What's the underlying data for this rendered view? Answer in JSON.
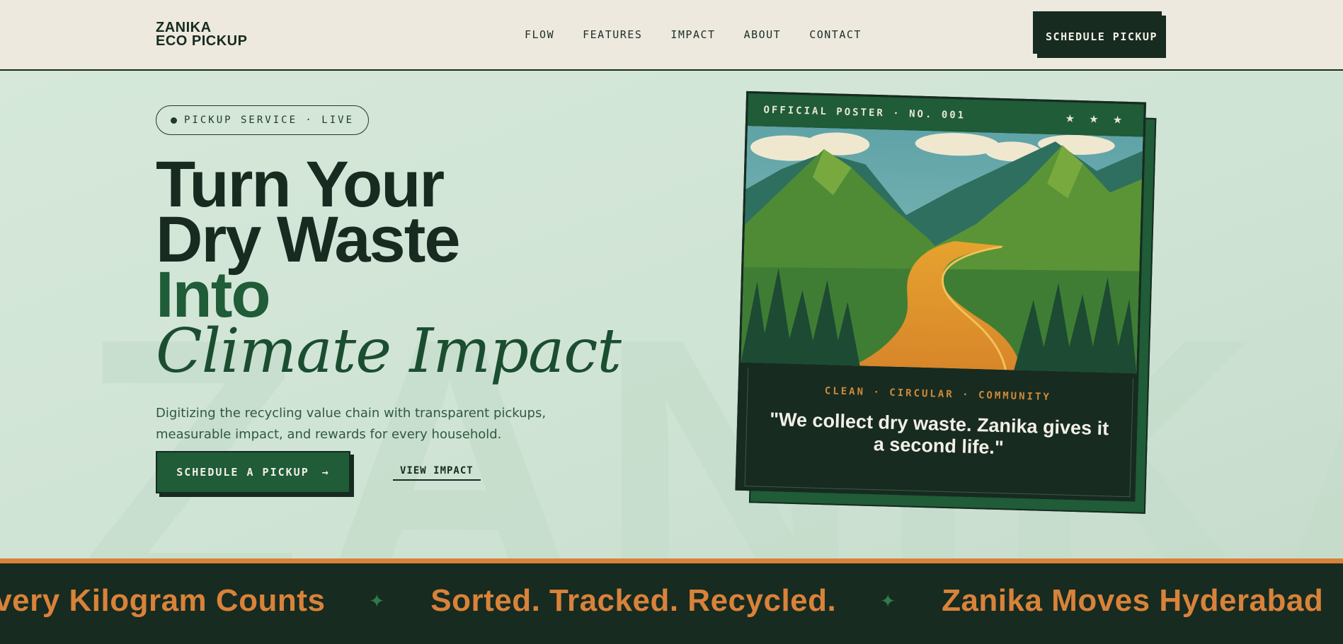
{
  "brand": {
    "line1": "ZANIKA",
    "line2": "ECO PICKUP"
  },
  "nav": {
    "links": [
      "FLOW",
      "FEATURES",
      "IMPACT",
      "ABOUT",
      "CONTACT"
    ],
    "cta": "SCHEDULE PICKUP"
  },
  "hero": {
    "badge": "PICKUP SERVICE · LIVE",
    "headline": {
      "line1": "Turn Your",
      "line2": "Dry Waste",
      "line3": "Into",
      "line4": "Climate Impact"
    },
    "subtext": "Digitizing the recycling value chain with transparent pickups, measurable impact, and rewards for every household.",
    "primary_cta": "SCHEDULE A PICKUP",
    "primary_cta_arrow": "→",
    "secondary_cta": "VIEW IMPACT",
    "background_word": "ZANIKA"
  },
  "poster": {
    "header": "OFFICIAL POSTER · NO. 001",
    "stars": "★ ★ ★",
    "tagline": "CLEAN · CIRCULAR · COMMUNITY",
    "quote": "\"We collect dry waste. Zanika gives it a second life.\""
  },
  "marquee": {
    "items": [
      "Every Kilogram Counts",
      "Sorted. Tracked. Recycled.",
      "Zanika Moves Hyderabad"
    ],
    "separator": "✦"
  },
  "colors": {
    "forest": "#172b20",
    "green": "#1f5c37",
    "mint": "#d3e6d8",
    "cream": "#ede9df",
    "orange": "#d9823a"
  }
}
